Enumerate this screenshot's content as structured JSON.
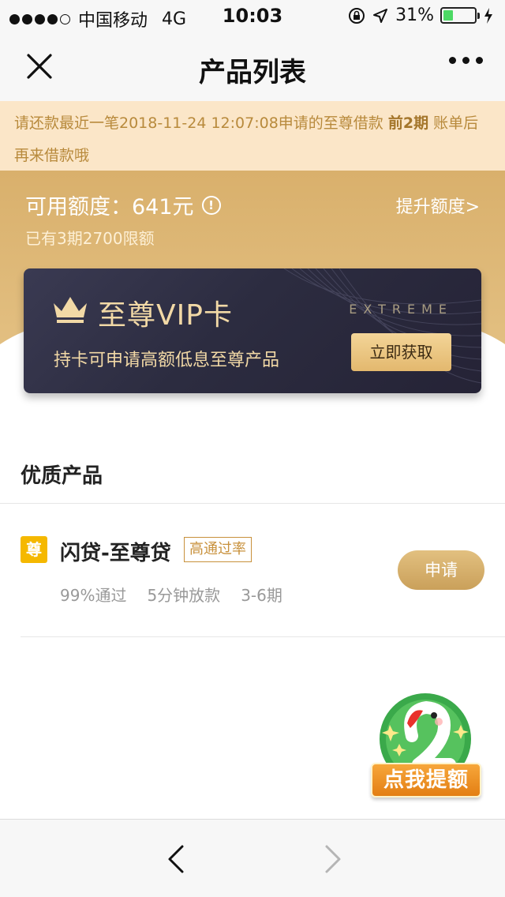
{
  "status_bar": {
    "carrier": "中国移动",
    "network": "4G",
    "time": "10:03",
    "battery": "31%",
    "battery_level": 0.31,
    "battery_color": "#4cd964"
  },
  "nav": {
    "title": "产品列表",
    "close_icon": "close-icon",
    "more_icon": "more-icon"
  },
  "notice": {
    "text_before": "请还款最近一笔2018-11-24 12:07:08申请的至尊借款 ",
    "highlight": "前2期",
    "text_after": " 账单后再来借款哦"
  },
  "quota": {
    "label": "可用额度：641元",
    "info_icon": "!",
    "boost_link": "提升额度>",
    "sub_text": "已有3期2700限额"
  },
  "vip_card": {
    "title": "至尊VIP卡",
    "brand": "EXTREME",
    "description": "持卡可申请高额低息至尊产品",
    "button": "立即获取"
  },
  "section": {
    "title": "优质产品"
  },
  "products": [
    {
      "badge": "尊",
      "name": "闪贷-至尊贷",
      "tag": "高通过率",
      "meta": [
        "99%通过",
        "5分钟放款",
        "3-6期"
      ],
      "button": "申请"
    }
  ],
  "float_widget": {
    "label": "点我提额"
  },
  "colors": {
    "gold": "#d9b06c",
    "notice_bg": "#fbe6c8",
    "vip_bg": "#2c2c40",
    "accent_text": "#f2d9a6"
  }
}
